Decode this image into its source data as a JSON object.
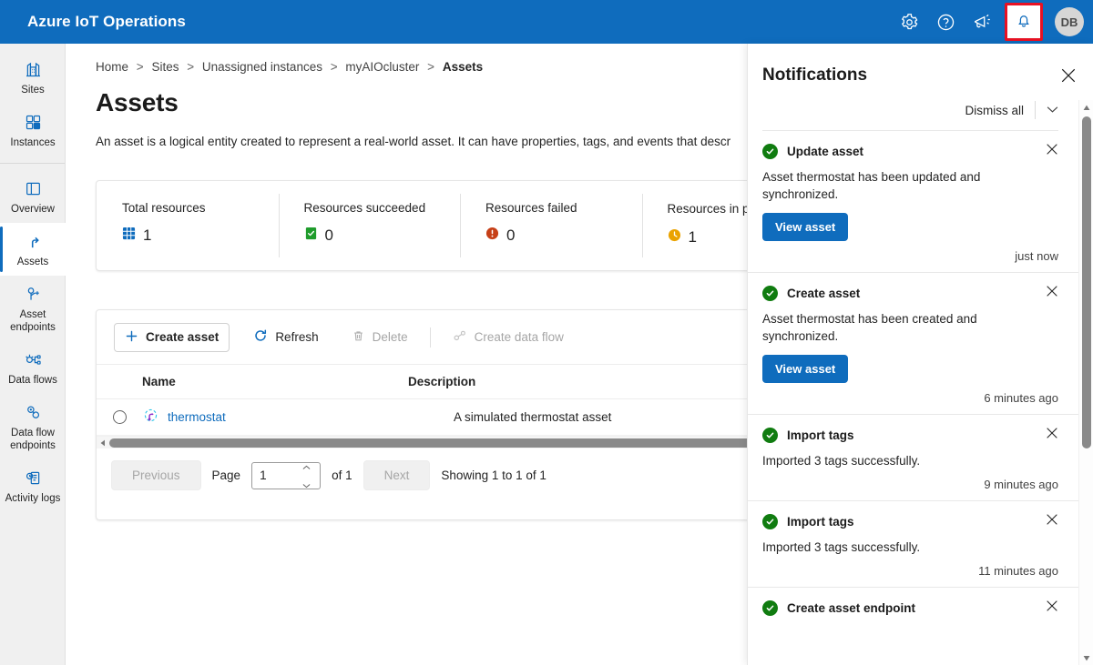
{
  "header": {
    "brand": "Azure IoT Operations",
    "settings_icon": "gear-icon",
    "help_icon": "question-circle-icon",
    "feedback_icon": "megaphone-icon",
    "notifications_icon": "bell-icon",
    "avatar_initials": "DB",
    "highlight_color": "#e81123",
    "bar_color": "#0f6cbd"
  },
  "sidebar": {
    "items": [
      {
        "label": "Sites",
        "icon": "sites-icon",
        "selected": false
      },
      {
        "label": "Instances",
        "icon": "instances-icon",
        "selected": false
      },
      {
        "label": "Overview",
        "icon": "overview-icon",
        "selected": false
      },
      {
        "label": "Assets",
        "icon": "assets-icon",
        "selected": true
      },
      {
        "label": "Asset endpoints",
        "icon": "asset-endpoints-icon",
        "selected": false
      },
      {
        "label": "Data flows",
        "icon": "data-flows-icon",
        "selected": false
      },
      {
        "label": "Data flow endpoints",
        "icon": "data-flow-endpoints-icon",
        "selected": false
      },
      {
        "label": "Activity logs",
        "icon": "activity-logs-icon",
        "selected": false
      }
    ]
  },
  "breadcrumb": {
    "items": [
      "Home",
      "Sites",
      "Unassigned instances",
      "myAIOcluster",
      "Assets"
    ],
    "separator": ">"
  },
  "page": {
    "title": "Assets",
    "description": "An asset is a logical entity created to represent a real-world asset. It can have properties, tags, and events that descr"
  },
  "stats": [
    {
      "label": "Total resources",
      "value": "1",
      "icon": "resources-grid-icon",
      "color": "#0f6cbd",
      "info": false
    },
    {
      "label": "Resources succeeded",
      "value": "0",
      "icon": "success-check-icon",
      "color": "#1f9c2c",
      "info": false
    },
    {
      "label": "Resources failed",
      "value": "0",
      "icon": "error-exclamation-icon",
      "color": "#c63f17",
      "info": false
    },
    {
      "label": "Resources in progress",
      "value": "1",
      "icon": "in-progress-clock-icon",
      "color": "#eaa300",
      "info": true
    }
  ],
  "toolbar": {
    "create_asset": "Create asset",
    "refresh": "Refresh",
    "delete": "Delete",
    "create_data_flow": "Create data flow"
  },
  "table": {
    "columns": [
      "Name",
      "Description"
    ],
    "rows": [
      {
        "name": "thermostat",
        "description": "A simulated thermostat asset",
        "icon": "asset-icon"
      }
    ]
  },
  "pagination": {
    "previous": "Previous",
    "page_label": "Page",
    "page_value": "1",
    "of_label": "of 1",
    "next": "Next",
    "showing": "Showing 1 to 1 of 1"
  },
  "notifications_panel": {
    "title": "Notifications",
    "close_icon": "close-icon",
    "dismiss_all": "Dismiss all",
    "collapse_icon": "chevron-down-icon",
    "items": [
      {
        "title": "Update asset",
        "status_icon": "success-check-icon",
        "body": "Asset thermostat has been updated and synchronized.",
        "action": "View asset",
        "time": "just now"
      },
      {
        "title": "Create asset",
        "status_icon": "success-check-icon",
        "body": "Asset thermostat has been created and synchronized.",
        "action": "View asset",
        "time": "6 minutes ago"
      },
      {
        "title": "Import tags",
        "status_icon": "success-check-icon",
        "body": "Imported 3 tags successfully.",
        "action": null,
        "time": "9 minutes ago"
      },
      {
        "title": "Import tags",
        "status_icon": "success-check-icon",
        "body": "Imported 3 tags successfully.",
        "action": null,
        "time": "11 minutes ago"
      },
      {
        "title": "Create asset endpoint",
        "status_icon": "success-check-icon",
        "body": null,
        "action": null,
        "time": null
      }
    ]
  }
}
